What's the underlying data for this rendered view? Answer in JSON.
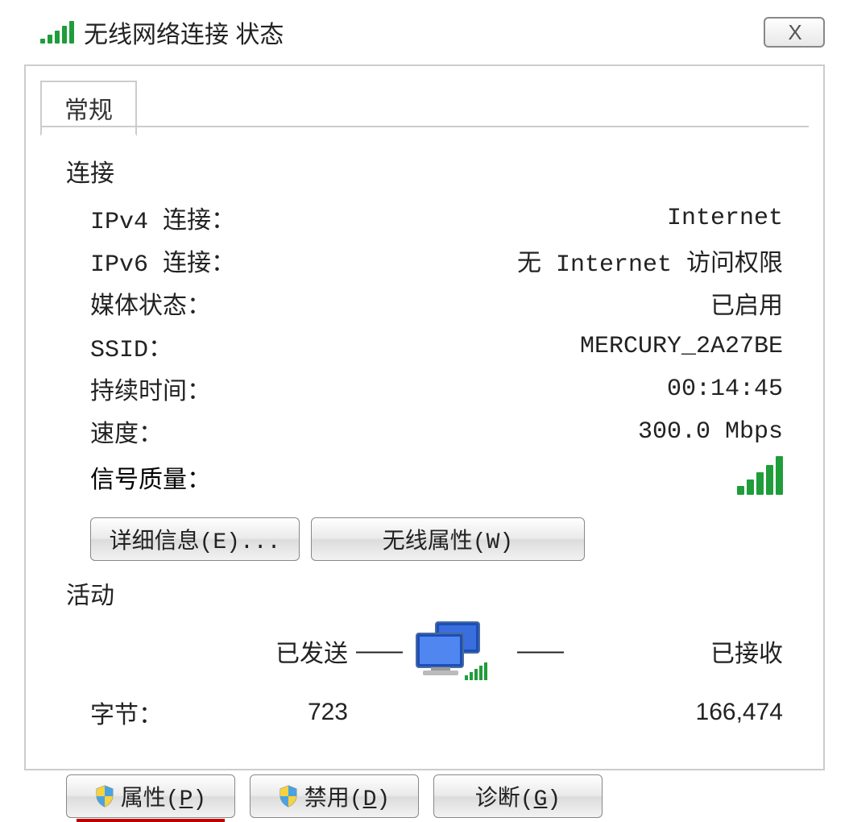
{
  "window": {
    "title": "无线网络连接 状态",
    "close_glyph": "X"
  },
  "tab": {
    "general": "常规"
  },
  "connection": {
    "section_label": "连接",
    "ipv4_label": "IPv4 连接：",
    "ipv4_value": "Internet",
    "ipv6_label": "IPv6 连接：",
    "ipv6_value": "无 Internet 访问权限",
    "media_label": "媒体状态：",
    "media_value": "已启用",
    "ssid_label": "SSID：",
    "ssid_value": "MERCURY_2A27BE",
    "duration_label": "持续时间：",
    "duration_value": "00:14:45",
    "speed_label": "速度：",
    "speed_value": "300.0 Mbps",
    "signal_label": "信号质量："
  },
  "buttons": {
    "details": "详细信息(E)...",
    "wireless_props": "无线属性(W)",
    "properties_prefix": "属性(",
    "properties_key": "P",
    "properties_suffix": ")",
    "disable_prefix": "禁用(",
    "disable_key": "D",
    "disable_suffix": ")",
    "diagnose_prefix": "诊断(",
    "diagnose_key": "G",
    "diagnose_suffix": ")"
  },
  "activity": {
    "section_label": "活动",
    "sent_label": "已发送",
    "received_label": "已接收",
    "dash": "——",
    "bytes_label": "字节：",
    "sent_value": "723",
    "received_value": "166,474"
  }
}
